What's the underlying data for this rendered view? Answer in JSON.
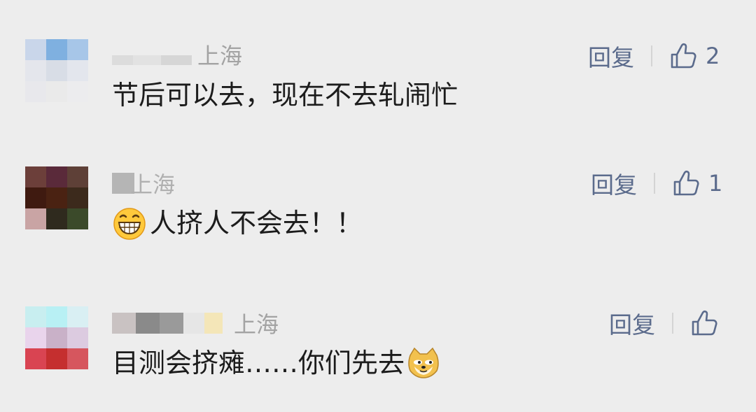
{
  "comments": [
    {
      "location": "上海",
      "text": "节后可以去，现在不去轧闹忙",
      "reply_label": "回复",
      "like_count": "2",
      "avatar_icon": "pixelated-avatar",
      "avatar_colors": [
        "#c9d6ea",
        "#7fb0e0",
        "#a7c6e8",
        "#e4e6ec",
        "#d8dde6",
        "#e3e6ed",
        "#e8e8ec",
        "#eaeaea",
        "#ececee"
      ]
    },
    {
      "location": "上海",
      "text": "人挤人不会去！！",
      "leading_emoji": "grinning-face-emoji",
      "reply_label": "回复",
      "like_count": "1",
      "avatar_icon": "pixelated-avatar",
      "avatar_colors": [
        "#6c3f3a",
        "#5a2a3a",
        "#5e4037",
        "#3f1a10",
        "#4a2212",
        "#3c2a1c",
        "#c9a4a4",
        "#2f2a1e",
        "#3b4a2a"
      ]
    },
    {
      "location": "上海",
      "text": "目测会挤瘫……你们先去",
      "trailing_emoji": "doge-emoji",
      "reply_label": "回复",
      "like_count": "",
      "avatar_icon": "pixelated-avatar",
      "avatar_colors": [
        "#c8eef0",
        "#b8f0f4",
        "#d9eff3",
        "#e9d4ec",
        "#c9b1c8",
        "#dccbe0",
        "#d94452",
        "#c52f2f",
        "#d6565e"
      ]
    }
  ],
  "colors": {
    "background": "#ededed",
    "reply": "#5b6b8c",
    "location": "#a3a3a3",
    "text": "#1c1c1c"
  }
}
